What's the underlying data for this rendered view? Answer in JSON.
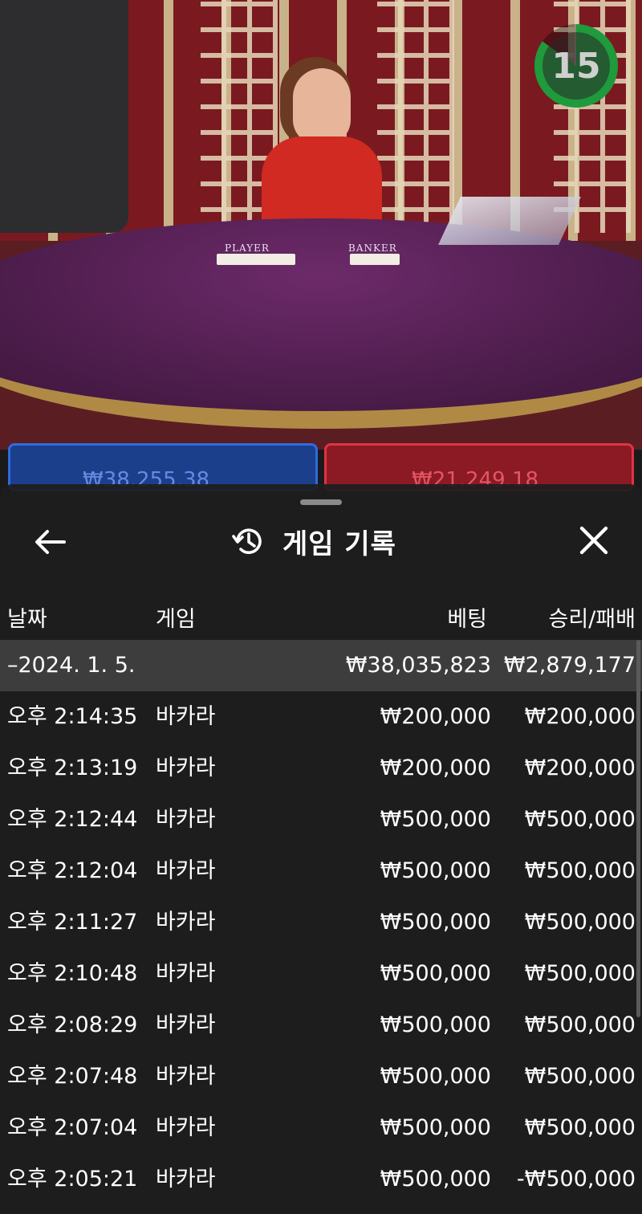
{
  "timer": {
    "value": "15",
    "progress": 0.85
  },
  "bet_preview": {
    "player_amount": "₩38,255.38",
    "banker_amount": "₩21,249.18"
  },
  "table_labels": {
    "player": "PLAYER",
    "banker": "BANKER"
  },
  "sheet": {
    "title": "게임 기록",
    "columns": {
      "date": "날짜",
      "game": "게임",
      "bet": "베팅",
      "result": "승리/패배"
    },
    "date_row": {
      "date": "–2024. 1. 5.",
      "bet": "₩38,035,823",
      "result": "₩2,879,177"
    },
    "rows": [
      {
        "time": "오후 2:14:35",
        "game": "바카라",
        "bet": "₩200,000",
        "result": "₩200,000"
      },
      {
        "time": "오후 2:13:19",
        "game": "바카라",
        "bet": "₩200,000",
        "result": "₩200,000"
      },
      {
        "time": "오후 2:12:44",
        "game": "바카라",
        "bet": "₩500,000",
        "result": "₩500,000"
      },
      {
        "time": "오후 2:12:04",
        "game": "바카라",
        "bet": "₩500,000",
        "result": "₩500,000"
      },
      {
        "time": "오후 2:11:27",
        "game": "바카라",
        "bet": "₩500,000",
        "result": "₩500,000"
      },
      {
        "time": "오후 2:10:48",
        "game": "바카라",
        "bet": "₩500,000",
        "result": "₩500,000"
      },
      {
        "time": "오후 2:08:29",
        "game": "바카라",
        "bet": "₩500,000",
        "result": "₩500,000"
      },
      {
        "time": "오후 2:07:48",
        "game": "바카라",
        "bet": "₩500,000",
        "result": "₩500,000"
      },
      {
        "time": "오후 2:07:04",
        "game": "바카라",
        "bet": "₩500,000",
        "result": "₩500,000"
      },
      {
        "time": "오후 2:05:21",
        "game": "바카라",
        "bet": "₩500,000",
        "result": "-₩500,000"
      }
    ]
  },
  "icons": {
    "back": "arrow-left-icon",
    "history": "history-icon",
    "close": "close-icon"
  },
  "colors": {
    "timer": "#1f9a3c",
    "player": "#2f6be0",
    "banker": "#e03344",
    "sheet_bg": "#1e1e1e",
    "date_row_bg": "#3d3d3d"
  }
}
